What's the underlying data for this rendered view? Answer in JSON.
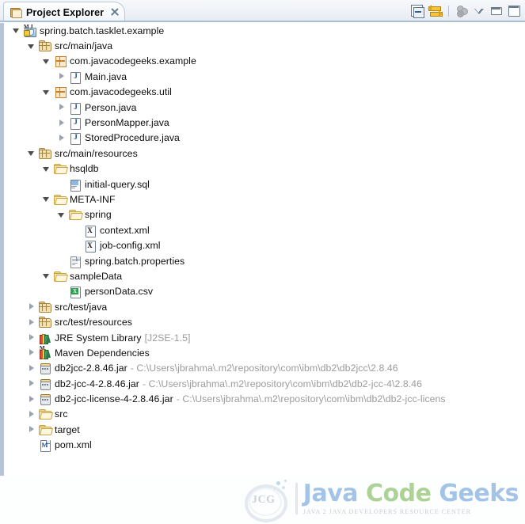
{
  "view": {
    "tab_title": "Project Explorer",
    "tab_icon": "folder-icon",
    "close_icon": "close-icon"
  },
  "toolbar": {
    "items": [
      {
        "name": "collapse-all-button",
        "title": "Collapse All"
      },
      {
        "name": "link-with-editor-button",
        "title": "Link with Editor"
      },
      {
        "name": "view-menu-button",
        "title": "View Menu"
      },
      {
        "name": "minimize-button",
        "title": "Minimize"
      },
      {
        "name": "maximize-button",
        "title": "Maximize"
      }
    ]
  },
  "tree": {
    "rows": [
      {
        "label": "spring.batch.tasklet.example",
        "sub": "",
        "depth": 0,
        "arrow": "expanded",
        "icon": "java-project-icon"
      },
      {
        "label": "src/main/java",
        "sub": "",
        "depth": 1,
        "arrow": "expanded",
        "icon": "source-folder-icon"
      },
      {
        "label": "com.javacodegeeks.example",
        "sub": "",
        "depth": 2,
        "arrow": "expanded",
        "icon": "package-icon"
      },
      {
        "label": "Main.java",
        "sub": "",
        "depth": 3,
        "arrow": "collapsed",
        "icon": "java-file-icon"
      },
      {
        "label": "com.javacodegeeks.util",
        "sub": "",
        "depth": 2,
        "arrow": "expanded",
        "icon": "package-icon"
      },
      {
        "label": "Person.java",
        "sub": "",
        "depth": 3,
        "arrow": "collapsed",
        "icon": "java-file-icon"
      },
      {
        "label": "PersonMapper.java",
        "sub": "",
        "depth": 3,
        "arrow": "collapsed",
        "icon": "java-file-icon"
      },
      {
        "label": "StoredProcedure.java",
        "sub": "",
        "depth": 3,
        "arrow": "collapsed",
        "icon": "java-file-icon"
      },
      {
        "label": "src/main/resources",
        "sub": "",
        "depth": 1,
        "arrow": "expanded",
        "icon": "source-folder-icon"
      },
      {
        "label": "hsqldb",
        "sub": "",
        "depth": 2,
        "arrow": "expanded",
        "icon": "folder-icon"
      },
      {
        "label": "initial-query.sql",
        "sub": "",
        "depth": 3,
        "arrow": "none",
        "icon": "sql-file-icon"
      },
      {
        "label": "META-INF",
        "sub": "",
        "depth": 2,
        "arrow": "expanded",
        "icon": "folder-icon"
      },
      {
        "label": "spring",
        "sub": "",
        "depth": 3,
        "arrow": "expanded",
        "icon": "folder-icon"
      },
      {
        "label": "context.xml",
        "sub": "",
        "depth": 4,
        "arrow": "none",
        "icon": "xml-file-icon"
      },
      {
        "label": "job-config.xml",
        "sub": "",
        "depth": 4,
        "arrow": "none",
        "icon": "xml-file-icon"
      },
      {
        "label": "spring.batch.properties",
        "sub": "",
        "depth": 3,
        "arrow": "none",
        "icon": "properties-file-icon"
      },
      {
        "label": "sampleData",
        "sub": "",
        "depth": 2,
        "arrow": "expanded",
        "icon": "folder-icon"
      },
      {
        "label": "personData.csv",
        "sub": "",
        "depth": 3,
        "arrow": "none",
        "icon": "csv-file-icon"
      },
      {
        "label": "src/test/java",
        "sub": "",
        "depth": 1,
        "arrow": "collapsed",
        "icon": "source-folder-icon"
      },
      {
        "label": "src/test/resources",
        "sub": "",
        "depth": 1,
        "arrow": "collapsed",
        "icon": "source-folder-icon"
      },
      {
        "label": "JRE System Library",
        "sub": "[J2SE-1.5]",
        "depth": 1,
        "arrow": "collapsed",
        "icon": "library-icon"
      },
      {
        "label": "Maven Dependencies",
        "sub": "",
        "depth": 1,
        "arrow": "collapsed",
        "icon": "maven-library-icon"
      },
      {
        "label": "db2jcc-2.8.46.jar",
        "sub": "- C:\\Users\\jbrahma\\.m2\\repository\\com\\ibm\\db2\\db2jcc\\2.8.46",
        "depth": 1,
        "arrow": "collapsed",
        "icon": "jar-icon"
      },
      {
        "label": "db2-jcc-4-2.8.46.jar",
        "sub": "- C:\\Users\\jbrahma\\.m2\\repository\\com\\ibm\\db2\\db2-jcc-4\\2.8.46",
        "depth": 1,
        "arrow": "collapsed",
        "icon": "jar-icon"
      },
      {
        "label": "db2-jcc-license-4-2.8.46.jar",
        "sub": "- C:\\Users\\jbrahma\\.m2\\repository\\com\\ibm\\db2\\db2-jcc-licens",
        "depth": 1,
        "arrow": "collapsed",
        "icon": "jar-icon"
      },
      {
        "label": "src",
        "sub": "",
        "depth": 1,
        "arrow": "collapsed",
        "icon": "folder-icon"
      },
      {
        "label": "target",
        "sub": "",
        "depth": 1,
        "arrow": "collapsed",
        "icon": "folder-icon"
      },
      {
        "label": "pom.xml",
        "sub": "",
        "depth": 1,
        "arrow": "none",
        "icon": "maven-pom-icon"
      }
    ]
  },
  "logo": {
    "mark": "JCG",
    "word1": "Java",
    "word2": "Code",
    "word3": "Geeks",
    "tagline": "JAVA 2 JAVA DEVELOPERS RESOURCE CENTER",
    "color_blue": "#9ec0e6",
    "color_green": "#a8cf8e"
  }
}
